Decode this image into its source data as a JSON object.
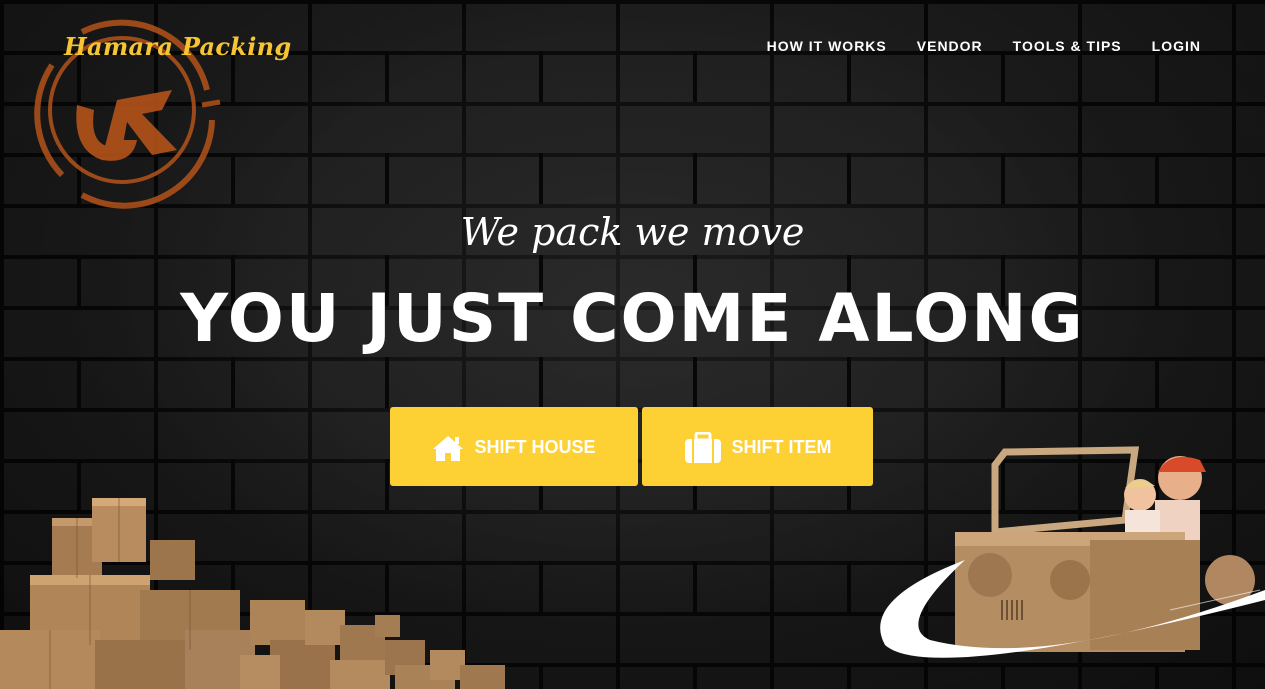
{
  "brand": {
    "name": "Hamara Packing",
    "logo_icon": "hp-circle-logo",
    "accent_color": "#f7c531",
    "logo_ring_color": "#b4531a"
  },
  "nav": {
    "items": [
      {
        "label": "HOW IT WORKS"
      },
      {
        "label": "VENDOR"
      },
      {
        "label": "TOOLS & TIPS"
      },
      {
        "label": "LOGIN"
      }
    ]
  },
  "hero": {
    "tagline": "We pack we move",
    "headline": "YOU JUST COME ALONG",
    "buttons": [
      {
        "label": "SHIFT HOUSE",
        "icon": "home-icon"
      },
      {
        "label": "SHIFT ITEM",
        "icon": "suitcase-icon"
      }
    ],
    "button_color": "#fdd034"
  },
  "decorations": {
    "left": "cardboard-boxes",
    "right": "kids-in-cardboard-car"
  }
}
